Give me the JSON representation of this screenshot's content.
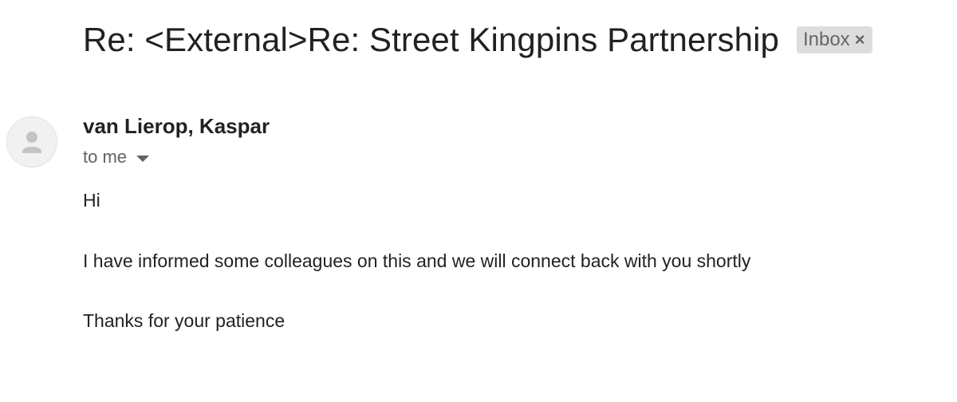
{
  "email": {
    "subject": "Re: <External>Re: Street Kingpins Partnership",
    "label": {
      "text": "Inbox",
      "close_glyph": "×"
    },
    "sender": {
      "name": "van Lierop, Kaspar",
      "avatar_icon": "person-icon"
    },
    "recipients_text": "to me",
    "body": [
      "Hi",
      "I have informed some colleagues on this and we will connect back with you shortly",
      "Thanks for your patience"
    ]
  },
  "colors": {
    "label_bg": "#dddddd",
    "label_text": "#666666",
    "secondary_text": "#5f6368",
    "primary_text": "#202124",
    "avatar_bg": "#f1f1f1",
    "avatar_glyph": "#c4c4c4"
  }
}
